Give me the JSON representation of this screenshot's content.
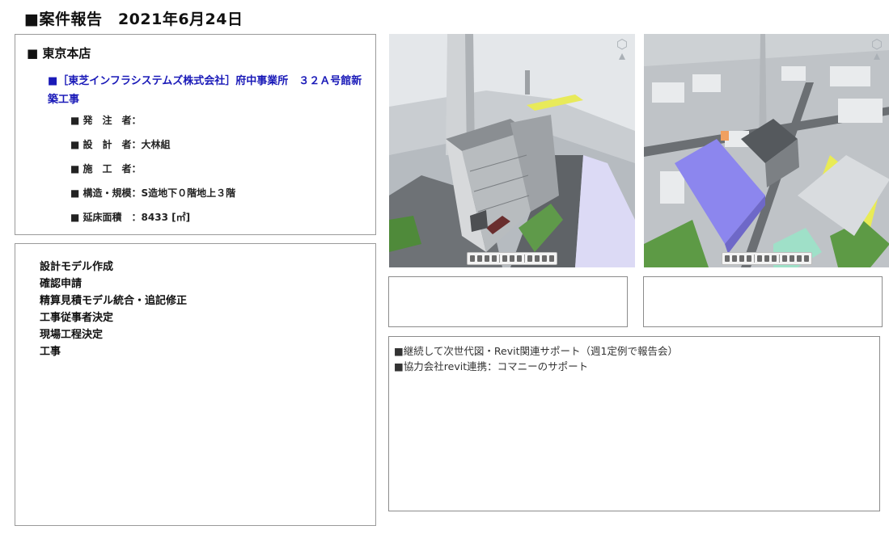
{
  "header": {
    "title": "■案件報告　2021年6月24日"
  },
  "info": {
    "office": "■ 東京本店",
    "project": "■［東芝インフラシステムズ株式会社］府中事業所　３２Ａ号館新築工事",
    "details": [
      "■ 発　注　者：",
      "■ 設　計　者：大林組",
      "■ 施　工　者：",
      "■ 構造・規模：S造地下０階地上３階",
      "■ 延床面積　：8433 [㎡]"
    ]
  },
  "steps": [
    "設計モデル作成",
    "確認申請",
    "精算見積モデル統合・追記修正",
    "工事従事者決定",
    "現場工程決定",
    "工事"
  ],
  "views": [
    {
      "name": "3D model view – street perspective",
      "caption": ""
    },
    {
      "name": "3D model view – aerial perspective",
      "caption": ""
    }
  ],
  "notes": [
    "■継続して次世代図・Revit関連サポート（週1定例で報告会）",
    "■協力会社revit連携：コマニーのサポート"
  ],
  "colors": {
    "project_text": "#1a1ab8",
    "border": "#9a9a9a"
  }
}
